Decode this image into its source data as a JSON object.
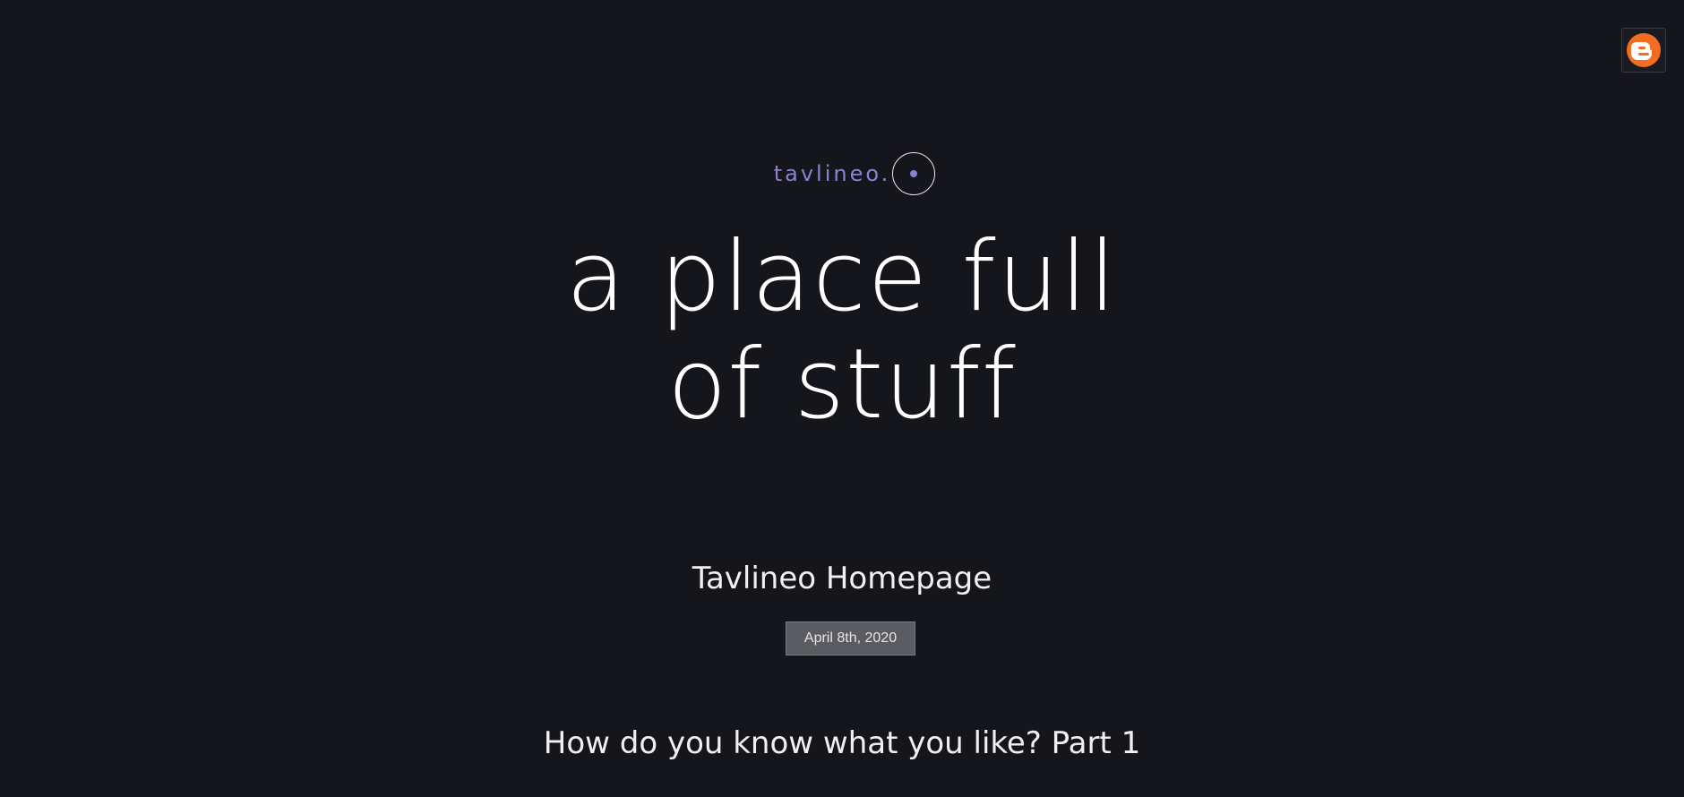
{
  "blogger_button": {
    "icon": "blogger-icon",
    "color": "#f26c21"
  },
  "brand": {
    "name": "tavlineo.",
    "accent": "#8b7fd6"
  },
  "hero": {
    "line1": "a place full",
    "line2": "of stuff"
  },
  "post": {
    "title": "Tavlineo Homepage",
    "date": "April 8th, 2020"
  },
  "next_post": {
    "title": "How do you know what you like? Part 1"
  }
}
